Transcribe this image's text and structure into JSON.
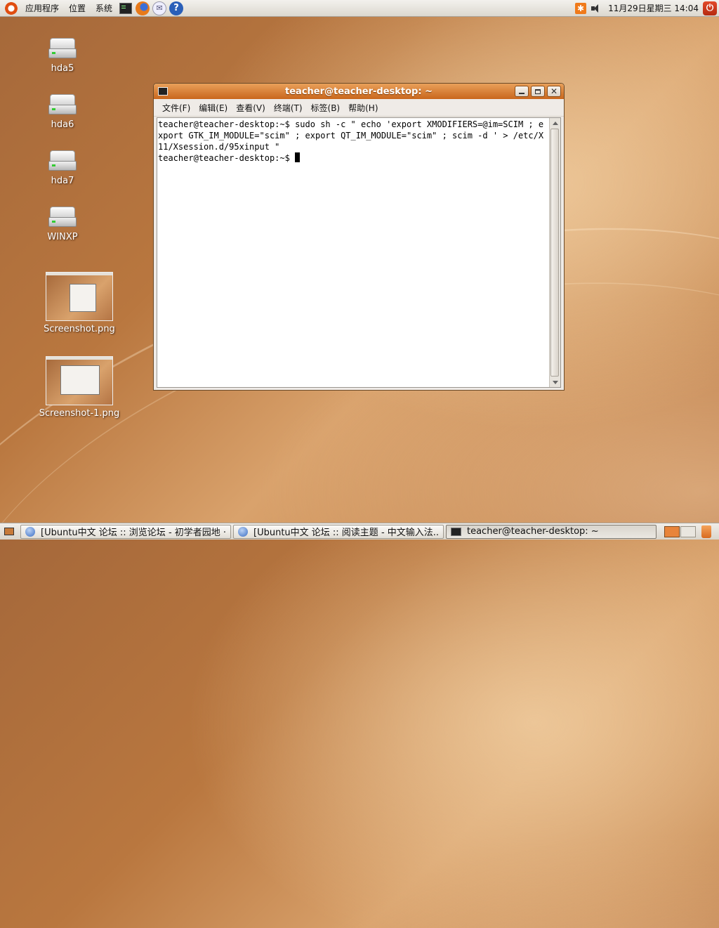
{
  "top_panel": {
    "menus": [
      "应用程序",
      "位置",
      "系统"
    ],
    "clock": "11月29日星期三 14:04",
    "icons": [
      "ubuntu-logo-icon",
      "terminal-icon",
      "firefox-icon",
      "mail-icon",
      "help-icon",
      "notification-icon",
      "volume-icon",
      "power-icon"
    ]
  },
  "desktop": {
    "icons": [
      {
        "label": "hda5"
      },
      {
        "label": "hda6"
      },
      {
        "label": "hda7"
      },
      {
        "label": "WINXP"
      },
      {
        "label": "Screenshot.png"
      },
      {
        "label": "Screenshot-1.png"
      }
    ]
  },
  "terminal": {
    "title": "teacher@teacher-desktop: ~",
    "menu": [
      "文件(F)",
      "编辑(E)",
      "查看(V)",
      "终端(T)",
      "标签(B)",
      "帮助(H)"
    ],
    "line1": "teacher@teacher-desktop:~$ sudo sh -c \" echo 'export XMODIFIERS=@im=SCIM ; export GTK_IM_MODULE=\"scim\" ; export QT_IM_MODULE=\"scim\" ; scim -d ' > /etc/X11/Xsession.d/95xinput \"",
    "prompt": "teacher@teacher-desktop:~$ "
  },
  "taskbar": {
    "tasks": [
      {
        "label": "[Ubuntu中文 论坛 :: 浏览论坛 - 初学者园地 ···"
      },
      {
        "label": "[Ubuntu中文 论坛 :: 阅读主题 - 中文输入法..."
      },
      {
        "label": "teacher@teacher-desktop: ~"
      }
    ]
  },
  "colors": {
    "titlebar": "#d57a2c",
    "accent": "#e04d10"
  }
}
